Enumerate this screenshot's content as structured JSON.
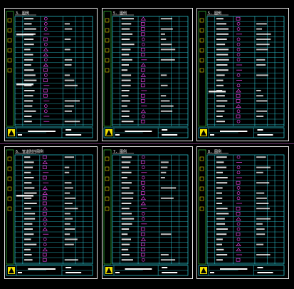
{
  "sheets": [
    {
      "title": "3. 图例",
      "left": "",
      "footer": "",
      "num": ""
    },
    {
      "title": "5. 图例",
      "left": "",
      "footer": "",
      "num": ""
    },
    {
      "title": "5. 图例",
      "left": "",
      "footer": "",
      "num": ""
    },
    {
      "title": "6. 管道附件图例",
      "left": "",
      "footer": "",
      "num": ""
    },
    {
      "title": "7. 图例",
      "left": "",
      "footer": "",
      "num": ""
    },
    {
      "title": "8. 图例",
      "left": "",
      "footer": "",
      "num": ""
    }
  ],
  "colors": {
    "frame": "#e8e8e8",
    "grid": "#2ed3e0",
    "text": "#ffffff",
    "symbol": "#e040e0",
    "title_bar": "#f0e000",
    "inner": "#40e040"
  }
}
